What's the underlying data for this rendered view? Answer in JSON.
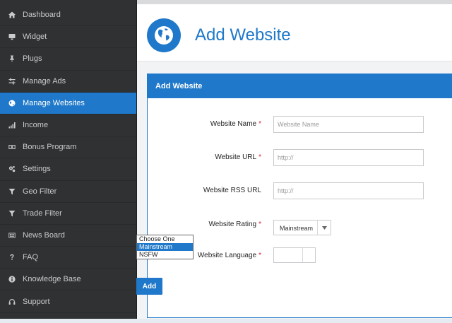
{
  "sidebar": {
    "items": [
      {
        "label": "Dashboard",
        "icon": "home-icon",
        "active": false
      },
      {
        "label": "Widget",
        "icon": "desktop-icon",
        "active": false
      },
      {
        "label": "Plugs",
        "icon": "pushpin-icon",
        "active": false
      },
      {
        "label": "Manage Ads",
        "icon": "sliders-icon",
        "active": false
      },
      {
        "label": "Manage Websites",
        "icon": "globe-icon",
        "active": true
      },
      {
        "label": "Income",
        "icon": "bar-chart-icon",
        "active": false
      },
      {
        "label": "Bonus Program",
        "icon": "money-icon",
        "active": false
      },
      {
        "label": "Settings",
        "icon": "cogs-icon",
        "active": false
      },
      {
        "label": "Geo Filter",
        "icon": "filter-icon",
        "active": false
      },
      {
        "label": "Trade Filter",
        "icon": "filter-icon",
        "active": false
      },
      {
        "label": "News Board",
        "icon": "newspaper-icon",
        "active": false
      },
      {
        "label": "FAQ",
        "icon": "question-icon",
        "active": false
      },
      {
        "label": "Knowledge Base",
        "icon": "info-circle-icon",
        "active": false
      },
      {
        "label": "Support",
        "icon": "headphones-icon",
        "active": false
      }
    ]
  },
  "header": {
    "title": "Add Website",
    "icon": "globe-icon"
  },
  "panel": {
    "heading": "Add Website"
  },
  "form": {
    "website_name": {
      "label": "Website Name",
      "required": "*",
      "placeholder": "Website Name",
      "value": ""
    },
    "website_url": {
      "label": "Website URL",
      "required": "*",
      "placeholder": "http://",
      "value": ""
    },
    "website_rss_url": {
      "label": "Website RSS URL",
      "placeholder": "http://",
      "value": ""
    },
    "website_rating": {
      "label": "Website Rating",
      "required": "*",
      "selected": "Mainstream",
      "options": [
        "Choose One",
        "Mainstream",
        "NSFW"
      ],
      "highlighted_option": "Mainstream"
    },
    "website_language": {
      "label": "Website Language",
      "required": "*",
      "selected": ""
    },
    "add_label": "Add"
  },
  "colors": {
    "accent": "#1f78c9",
    "sidebar_bg": "#2f3133",
    "required": "#d9232d"
  }
}
